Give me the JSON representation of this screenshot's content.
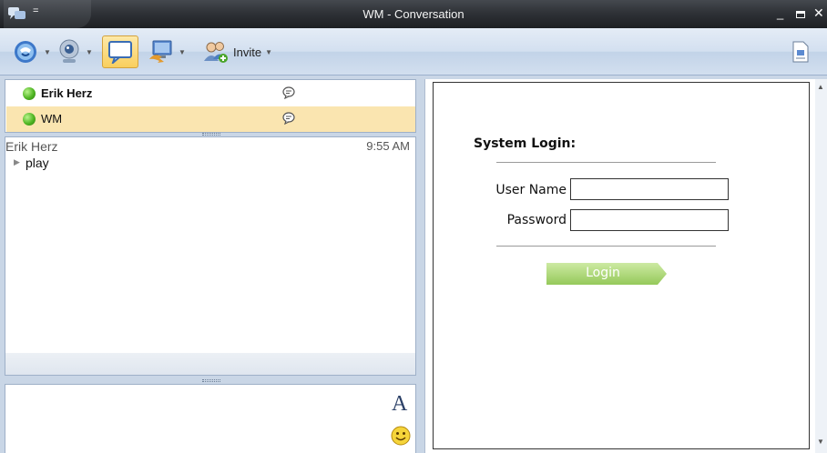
{
  "window": {
    "title": "WM - Conversation",
    "qat_arrow": "=",
    "min_glyph": "_",
    "close_glyph": "✕"
  },
  "toolbar": {
    "invite_label": "Invite"
  },
  "contacts": [
    {
      "name": "Erik Herz",
      "status": "online",
      "bold": true
    },
    {
      "name": "WM",
      "status": "online",
      "bold": false,
      "selected": true
    }
  ],
  "history": {
    "sender": "Erik Herz",
    "time": "9:55 AM",
    "message": "play"
  },
  "compose": {
    "font_glyph": "A"
  },
  "login": {
    "title": "System Login:",
    "username_label": "User Name",
    "password_label": "Password",
    "username_value": "",
    "password_value": "",
    "button_label": "Login"
  },
  "colors": {
    "titlebar": "#2f3237",
    "selected_row": "#fae5b0",
    "presence_online": "#4fb523",
    "login_button": "#a9d66e"
  }
}
